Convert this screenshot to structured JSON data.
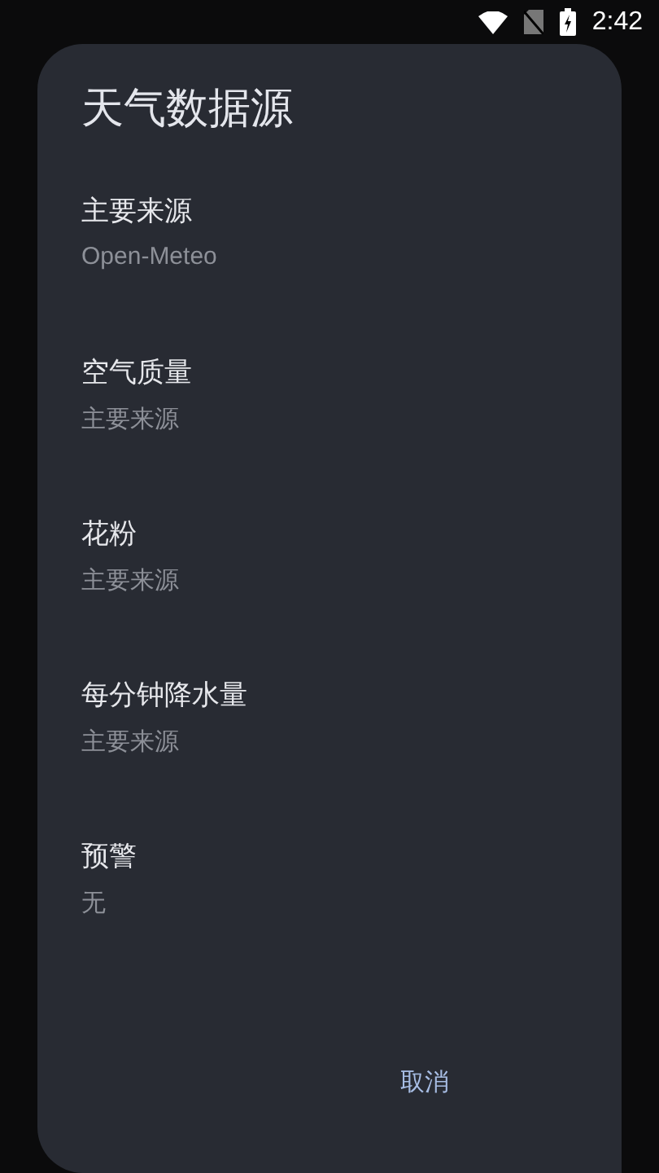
{
  "status_bar": {
    "time": "2:42"
  },
  "dialog": {
    "title": "天气数据源",
    "items": [
      {
        "label": "主要来源",
        "value": "Open-Meteo"
      },
      {
        "label": "空气质量",
        "value": "主要来源"
      },
      {
        "label": "花粉",
        "value": "主要来源"
      },
      {
        "label": "每分钟降水量",
        "value": "主要来源"
      },
      {
        "label": "预警",
        "value": "无"
      }
    ],
    "buttons": [
      "取消"
    ]
  }
}
